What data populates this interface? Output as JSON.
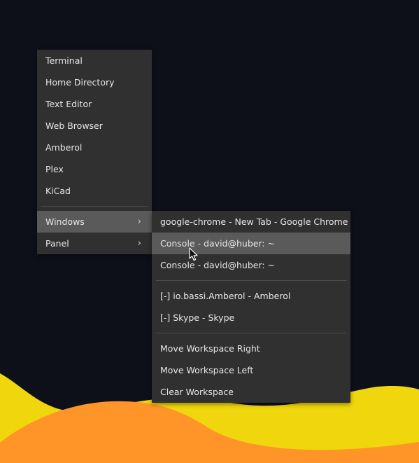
{
  "desktop": {
    "colors": {
      "background": "#0e1019",
      "wave_yellow": "#f0d60c",
      "wave_orange": "#ff9429"
    }
  },
  "main_menu": {
    "items": [
      {
        "label": "Terminal"
      },
      {
        "label": "Home Directory"
      },
      {
        "label": "Text Editor"
      },
      {
        "label": "Web Browser"
      },
      {
        "label": "Amberol"
      },
      {
        "label": "Plex"
      },
      {
        "label": "KiCad"
      }
    ],
    "submenus": [
      {
        "label": "Windows",
        "arrow": "›",
        "highlighted": true
      },
      {
        "label": "Panel",
        "arrow": "›",
        "highlighted": false
      }
    ]
  },
  "windows_menu": {
    "windows": [
      {
        "label": "google-chrome - New Tab - Google Chrome"
      },
      {
        "label": "Console - david@huber: ~",
        "highlighted": true
      },
      {
        "label": "Console - david@huber: ~"
      }
    ],
    "minimized": [
      {
        "label": "[-] io.bassi.Amberol - Amberol"
      },
      {
        "label": "[-] Skype - Skype"
      }
    ],
    "actions": [
      {
        "label": "Move Workspace Right"
      },
      {
        "label": "Move Workspace Left"
      },
      {
        "label": "Clear Workspace"
      }
    ]
  },
  "icons": {
    "cursor": "mouse-pointer-icon",
    "submenu_arrow": "chevron-right-icon"
  }
}
